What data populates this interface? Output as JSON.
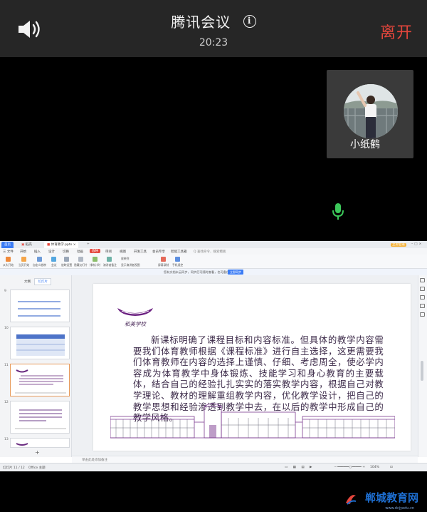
{
  "meeting": {
    "title": "腾讯会议",
    "time": "20:23",
    "leave_label": "离开",
    "icons": {
      "speaker": "speaker-icon",
      "info": "info-icon",
      "mic": "microphone-icon"
    },
    "colors": {
      "leave": "#e5463c",
      "mic": "#3cc85a",
      "topbar": "#262626"
    }
  },
  "participant": {
    "name": "小纸鹤"
  },
  "wps": {
    "tabs": [
      "首页",
      "稻壳",
      "体育教学.pptx"
    ],
    "login_label": "立即登录",
    "menu": [
      "三 文件",
      "开始",
      "插入",
      "设计",
      "切换",
      "动画",
      "放映",
      "审阅",
      "视图",
      "开发工具",
      "会员专享",
      "智能工具箱",
      "Q 查找命令、搜索模板"
    ],
    "active_menu": "放映",
    "ribbon": [
      "从头开始",
      "当页开始",
      "自定义放映",
      "会议",
      "放映设置",
      "隐藏幻灯片",
      "排练计时",
      "演讲者备注",
      "放映到",
      "显示演讲者视图",
      "屏幕录制",
      "手机遥控"
    ],
    "notice": "您有文档未云同步，同步后可随时查看，也可备份",
    "notice_button": "立即同步",
    "panel_tabs": [
      "大纲",
      "幻灯片"
    ],
    "thumb_numbers": [
      "9",
      "10",
      "11",
      "12",
      "13"
    ],
    "note_placeholder": "单击此处添加备注",
    "status": {
      "slide": "幻灯片 11 / 12",
      "theme": "Office 主题",
      "zoom": "104%"
    },
    "colors": {
      "accent": "#3b7cf5",
      "active_tab": "#e5463c"
    }
  },
  "slide": {
    "logo_text": "和美学校",
    "body": "新课标明确了课程目标和内容标准。但具体的教学内容需要我们体育教师根据《课程标准》进行自主选择，这更需要我们体育教师在内容的选择上谨慎、仔细、考虑周全，使必学内容成为体育教学中身体锻炼、技能学习和身心教育的主要载体，结合自己的经验扎扎实实的落实教学内容，根据自己对教学理论、教材的理解重组教学内容，优化教学设计，把自己的教学思想和经验渗透到教学中去，在以后的教学中形成自己的教学风格。",
    "color": "#7b2d8e"
  },
  "watermark": {
    "text": "郸城教育网",
    "url": "www.dcjyedu.cn"
  }
}
